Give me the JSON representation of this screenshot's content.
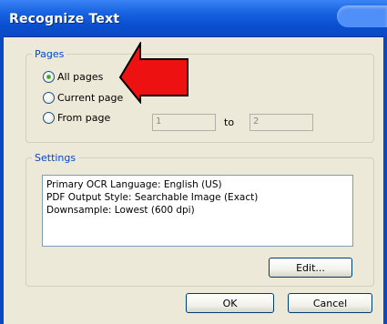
{
  "window": {
    "title": "Recognize Text"
  },
  "pages": {
    "legend": "Pages",
    "options": [
      {
        "label": "All pages",
        "checked": true
      },
      {
        "label": "Current page",
        "checked": false
      },
      {
        "label": "From page",
        "checked": false
      }
    ],
    "from_value": "1",
    "to_label": "to",
    "to_value": "2"
  },
  "settings": {
    "legend": "Settings",
    "lines": [
      "Primary OCR Language: English (US)",
      "PDF Output Style: Searchable Image (Exact)",
      "Downsample: Lowest (600 dpi)"
    ],
    "edit_label": "Edit..."
  },
  "buttons": {
    "ok_label": "OK",
    "cancel_label": "Cancel"
  },
  "annotation": {
    "arrow_color": "#ee1111",
    "arrow_icon": "red-arrow-icon"
  }
}
